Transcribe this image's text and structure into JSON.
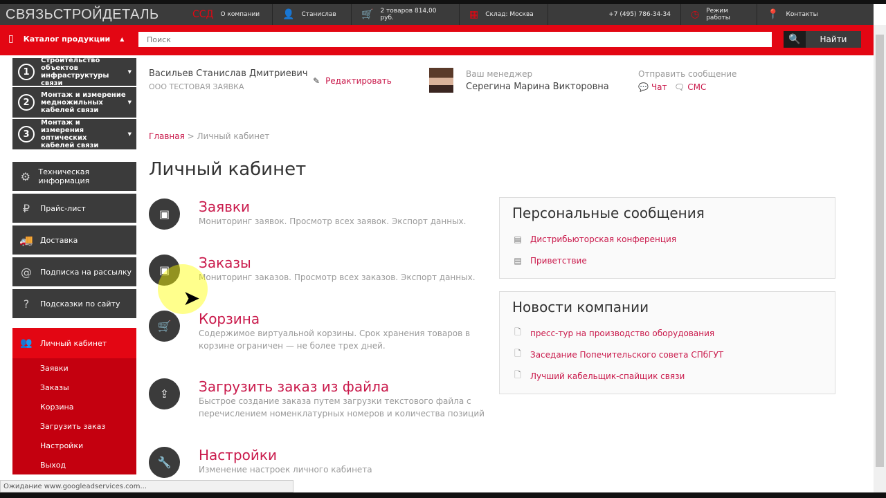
{
  "header": {
    "logo": "СВЯЗЬСТРОЙДЕТАЛЬ",
    "items": [
      {
        "label": "О компании",
        "icon": "ssd-logo-icon"
      },
      {
        "label": "Станислав",
        "icon": "user-icon"
      },
      {
        "label": "2 товаров 814,00 руб.",
        "icon": "cart-icon"
      },
      {
        "label": "Склад: Москва",
        "icon": "warehouse-icon"
      },
      {
        "label": "+7 (495) 786-34-34"
      },
      {
        "label": "Режим работы",
        "icon": "clock-icon"
      },
      {
        "label": "Контакты",
        "icon": "map-pin-icon"
      }
    ]
  },
  "searchbar": {
    "catalog": "Каталог продукции",
    "placeholder": "Поиск",
    "button": "Найти"
  },
  "sidebar": {
    "categories": [
      {
        "num": "1",
        "label": "Строительство объектов инфраструктуры связи"
      },
      {
        "num": "2",
        "label": "Монтаж и измерение медножильных кабелей связи"
      },
      {
        "num": "3",
        "label": "Монтаж и измерения оптических кабелей связи"
      }
    ],
    "nav": [
      {
        "label": "Техническая информация",
        "icon": "gear-icon"
      },
      {
        "label": "Прайс-лист",
        "icon": "price-icon"
      },
      {
        "label": "Доставка",
        "icon": "truck-icon"
      },
      {
        "label": "Подписка на рассылку",
        "icon": "at-icon"
      },
      {
        "label": "Подсказки по сайту",
        "icon": "question-icon"
      }
    ],
    "account": "Личный кабинет",
    "sub": [
      "Заявки",
      "Заказы",
      "Корзина",
      "Загрузить заказ",
      "Настройки",
      "Выход"
    ]
  },
  "user": {
    "name": "Васильев Станислав Дмитриевич",
    "company": "ООО ТЕСТОВАЯ ЗАЯВКА",
    "edit": "Редактировать"
  },
  "manager": {
    "label": "Ваш менеджер",
    "name": "Серегина Марина Викторовна"
  },
  "message": {
    "label": "Отправить сообщение",
    "chat": "Чат",
    "sms": "СМС"
  },
  "breadcrumb": {
    "home": "Главная",
    "sep": " > ",
    "current": "Личный кабинет"
  },
  "title": "Личный кабинет",
  "sections": [
    {
      "title": "Заявки",
      "desc": "Мониторинг заявок. Просмотр всех заявок. Экспорт данных.",
      "icon": "inbox-icon"
    },
    {
      "title": "Заказы",
      "desc": "Мониторинг заказов. Просмотр всех заказов. Экспорт данных.",
      "icon": "inbox-icon"
    },
    {
      "title": "Корзина",
      "desc": "Содержимое виртуальной корзины. Срок хранения товаров в корзине ограничен — не более трех дней.",
      "icon": "cart-icon"
    },
    {
      "title": "Загрузить заказ из файла",
      "desc": "Быстрое создание заказа путем загрузки текстового файла с перечислением номенклатурных номеров и количества позиций",
      "icon": "upload-icon"
    },
    {
      "title": "Настройки",
      "desc": "Изменение настроек личного кабинета",
      "icon": "wrench-icon"
    }
  ],
  "messages": {
    "title": "Персональные сообщения",
    "items": [
      "Дистрибьюторская конференция",
      "Приветствие"
    ]
  },
  "news": {
    "title": "Новости компании",
    "items": [
      "пресс-тур на производство оборудования",
      "Заседание Попечительского совета СПбГУТ",
      "Лучший кабельщик-спайщик связи"
    ]
  },
  "status": "Ожидание www.googleadservices.com..."
}
